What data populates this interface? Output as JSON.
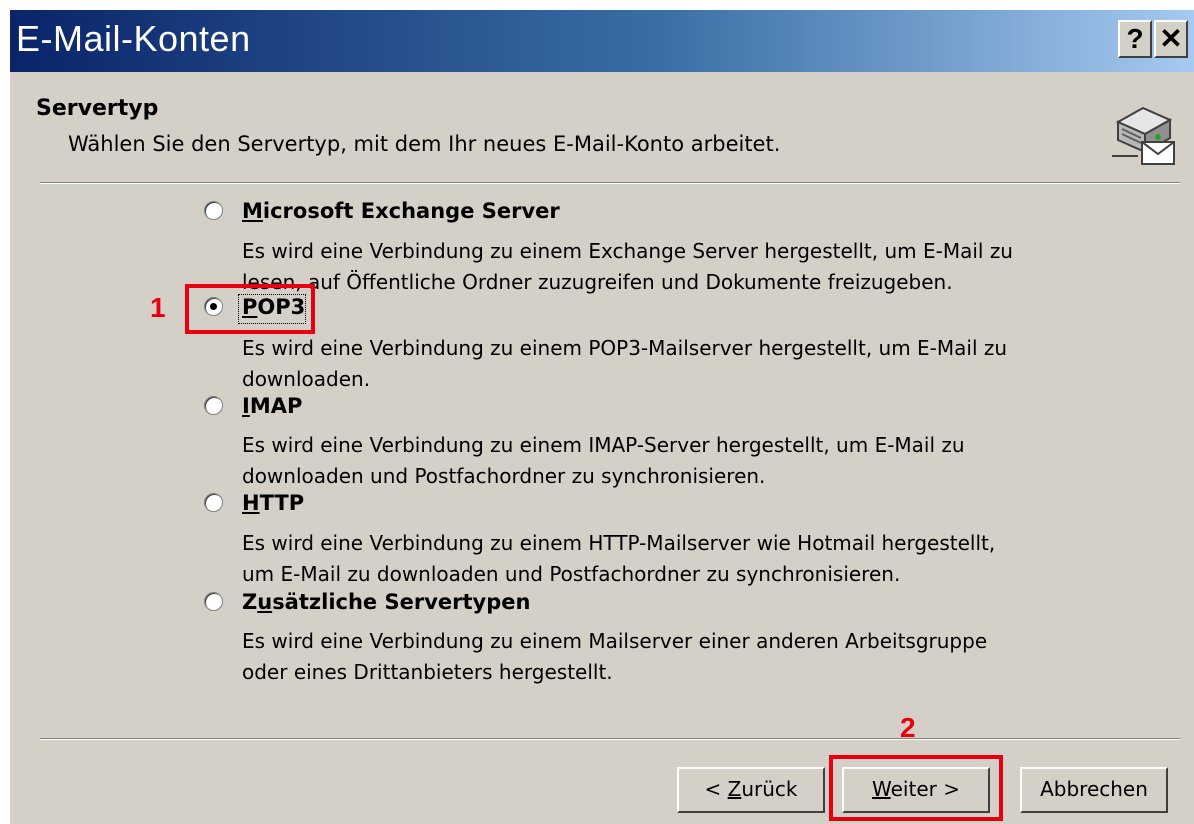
{
  "window": {
    "title": "E-Mail-Konten",
    "help_button": "?",
    "close_button": "✕"
  },
  "header": {
    "title": "Servertyp",
    "description": "Wählen Sie den Servertyp, mit dem Ihr neues E-Mail-Konto arbeitet.",
    "icon": "mail-server-icon"
  },
  "options": [
    {
      "label_pre": "",
      "label_key": "M",
      "label_post": "icrosoft Exchange Server",
      "selected": false,
      "desc_lines": [
        "Es wird eine Verbindung zu einem Exchange Server hergestellt, um E-Mail zu",
        "lesen, auf Öffentliche Ordner zuzugreifen und Dokumente freizugeben."
      ]
    },
    {
      "label_pre": "",
      "label_key": "P",
      "label_post": "OP3",
      "selected": true,
      "desc_lines": [
        "Es wird eine Verbindung zu einem POP3-Mailserver hergestellt, um E-Mail zu",
        "downloaden."
      ]
    },
    {
      "label_pre": "",
      "label_key": "I",
      "label_post": "MAP",
      "selected": false,
      "desc_lines": [
        "Es wird eine Verbindung zu einem IMAP-Server hergestellt, um E-Mail zu",
        "downloaden und Postfachordner zu synchronisieren."
      ]
    },
    {
      "label_pre": "",
      "label_key": "H",
      "label_post": "TTP",
      "selected": false,
      "desc_lines": [
        "Es wird eine Verbindung zu einem HTTP-Mailserver wie Hotmail hergestellt,",
        "um E-Mail zu downloaden und Postfachordner zu synchronisieren."
      ]
    },
    {
      "label_pre": "Z",
      "label_key": "u",
      "label_post": "sätzliche Servertypen",
      "selected": false,
      "desc_lines": [
        "Es wird eine Verbindung zu einem Mailserver einer anderen Arbeitsgruppe",
        "oder eines Drittanbieters hergestellt."
      ]
    }
  ],
  "annotations": {
    "marker_1": "1",
    "marker_2": "2",
    "highlight_color": "#e8000f"
  },
  "buttons": {
    "back_pre": "< ",
    "back_key": "Z",
    "back_post": "urück",
    "next_key": "W",
    "next_post": "eiter >",
    "cancel": "Abbrechen"
  }
}
